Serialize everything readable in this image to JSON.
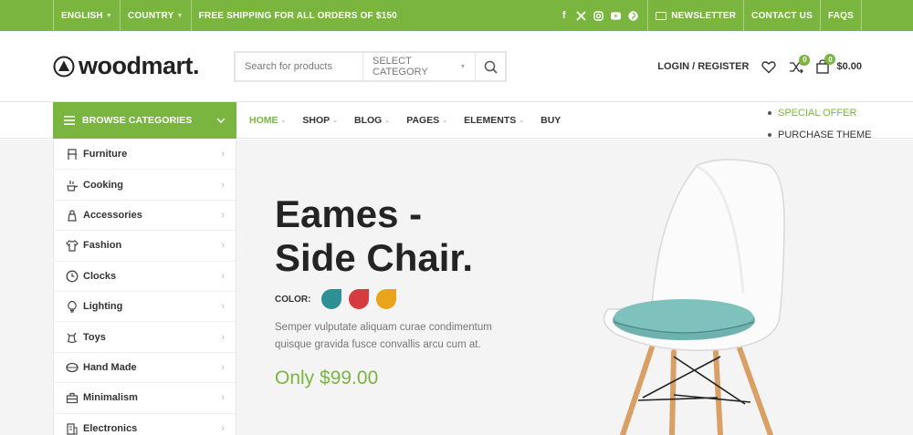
{
  "topbar": {
    "language": "ENGLISH",
    "country": "COUNTRY",
    "promo": "FREE SHIPPING FOR ALL ORDERS OF $150",
    "newsletter": "NEWSLETTER",
    "contact": "CONTACT US",
    "faqs": "FAQS",
    "social_icons": [
      "facebook-icon",
      "x-icon",
      "instagram-icon",
      "youtube-icon",
      "pinterest-icon"
    ]
  },
  "header": {
    "logo_text": "woodmart.",
    "search_placeholder": "Search for products",
    "search_category": "SELECT CATEGORY",
    "login": "LOGIN / REGISTER",
    "compare_count": "0",
    "cart_count": "0",
    "cart_total": "$0.00"
  },
  "nav": {
    "browse_label": "BROWSE CATEGORIES",
    "menu": [
      {
        "label": "HOME",
        "active": true
      },
      {
        "label": "SHOP"
      },
      {
        "label": "BLOG"
      },
      {
        "label": "PAGES"
      },
      {
        "label": "ELEMENTS"
      },
      {
        "label": "BUY"
      }
    ],
    "special_offer": "SPECIAL OFFER",
    "purchase_theme": "PURCHASE THEME"
  },
  "categories": [
    {
      "label": "Furniture",
      "icon": "chair-icon"
    },
    {
      "label": "Cooking",
      "icon": "cooking-icon"
    },
    {
      "label": "Accessories",
      "icon": "accessories-icon"
    },
    {
      "label": "Fashion",
      "icon": "shirt-icon"
    },
    {
      "label": "Clocks",
      "icon": "clock-icon"
    },
    {
      "label": "Lighting",
      "icon": "bulb-icon"
    },
    {
      "label": "Toys",
      "icon": "toy-icon"
    },
    {
      "label": "Hand Made",
      "icon": "handmade-icon"
    },
    {
      "label": "Minimalism",
      "icon": "minimalism-icon"
    },
    {
      "label": "Electronics",
      "icon": "electronics-icon"
    }
  ],
  "hero": {
    "title_line1": "Eames -",
    "title_line2": "Side Chair.",
    "color_label": "COLOR:",
    "colors": [
      "#2e8f94",
      "#d63b3f",
      "#eaa31a"
    ],
    "description": "Semper vulputate aliquam curae condimentum quisque gravida fusce convallis arcu cum at.",
    "price": "Only $99.00"
  },
  "theme": {
    "accent": "#7ab63f"
  }
}
